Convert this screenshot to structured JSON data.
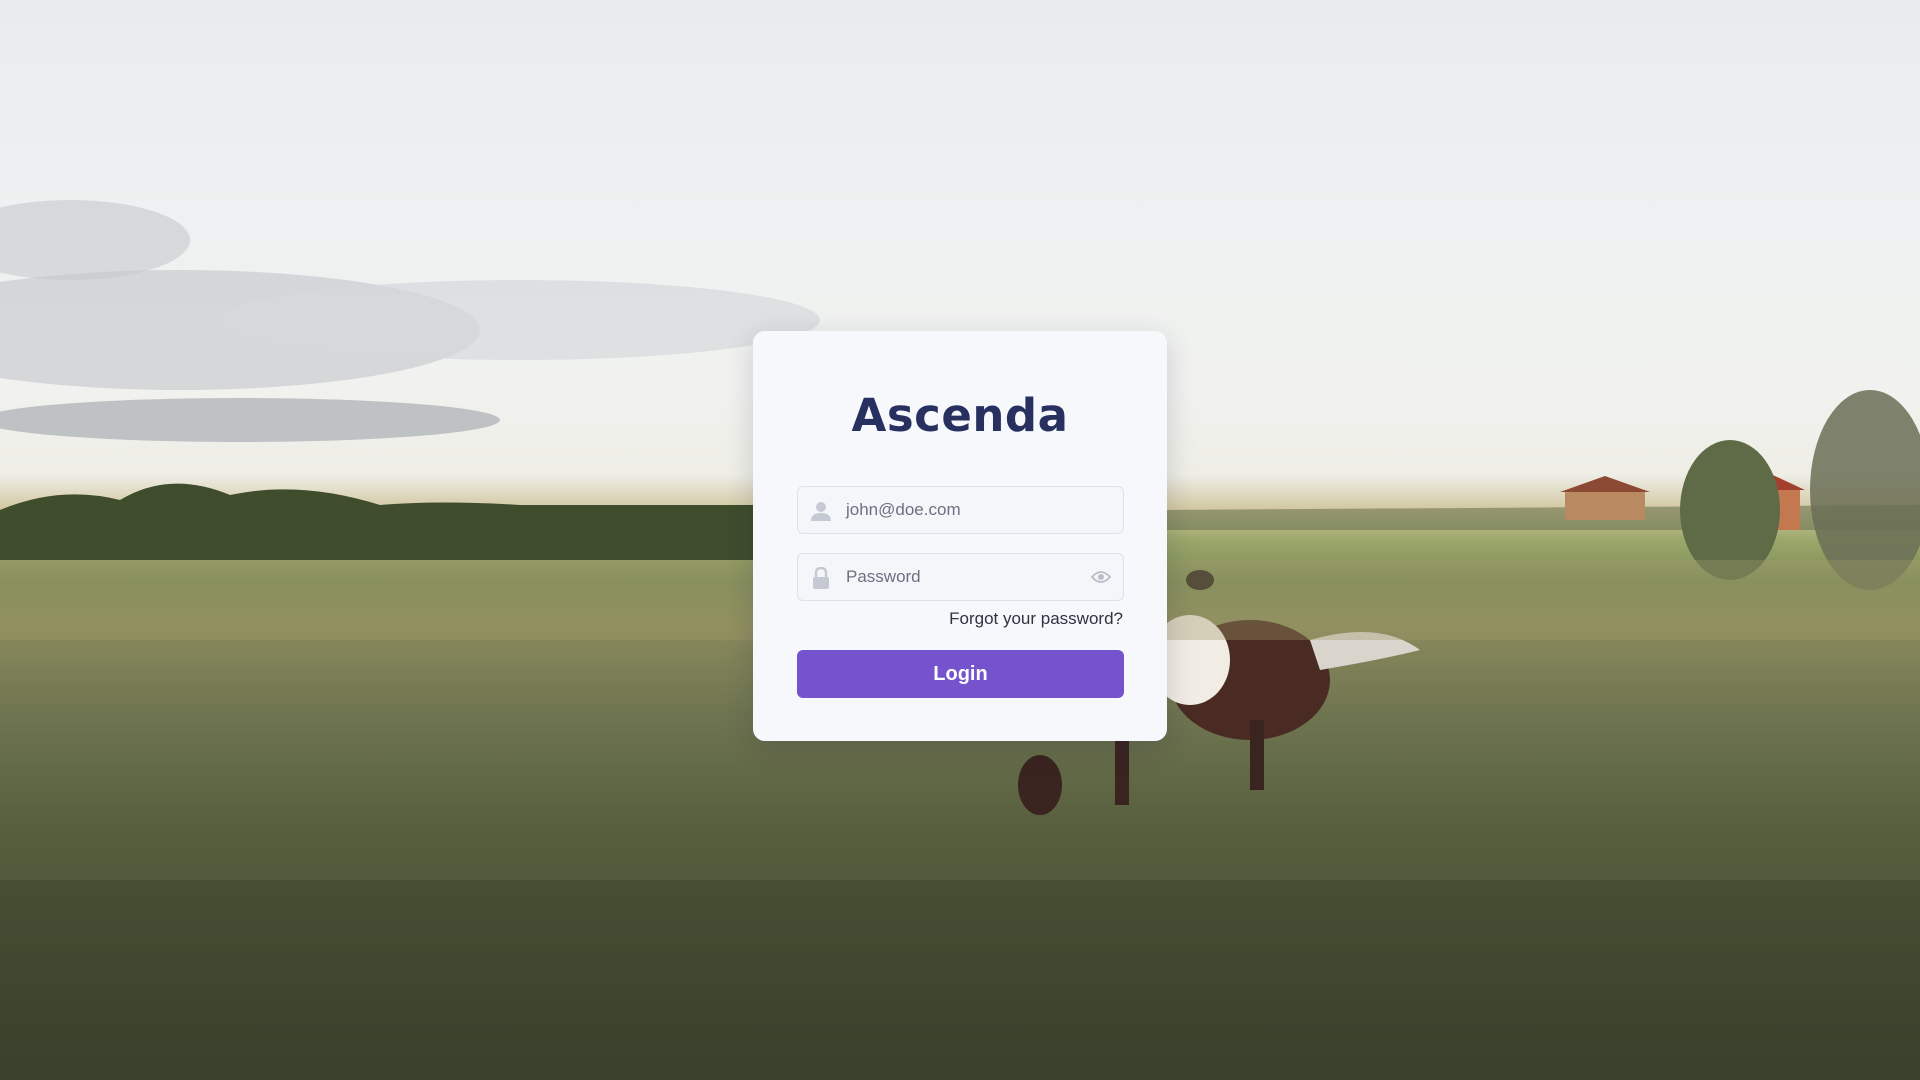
{
  "brand": {
    "name": "Ascenda"
  },
  "login_form": {
    "email_placeholder": "john@doe.com",
    "password_placeholder": "Password",
    "forgot_password_link": "Forgot your password?",
    "login_button": "Login"
  },
  "icons": {
    "email_field": "user-icon",
    "password_field": "lock-icon",
    "password_toggle": "eye-icon"
  },
  "colors": {
    "brand_text": "#27305f",
    "primary_button": "#7453cc",
    "card_background": "#f6f8fb"
  }
}
